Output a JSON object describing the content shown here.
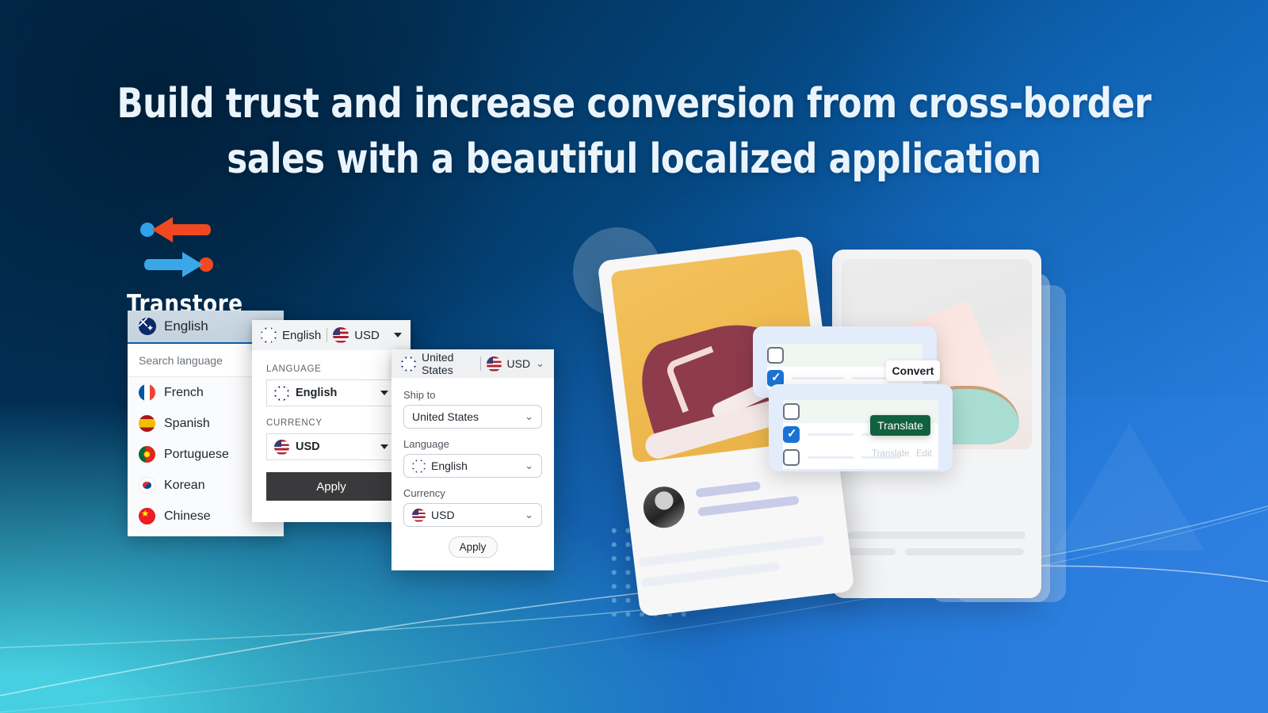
{
  "hero": {
    "headline": "Build trust and increase conversion from cross-border\nsales with a beautiful localized application",
    "headline_color": "#eaf4fc"
  },
  "logo": {
    "wordmark": "Transtore",
    "arrow_left_color": "#f1491f",
    "arrow_right_color": "#3aa8e8",
    "dot_left_color": "#2fa3e8",
    "dot_right_color": "#f1491f"
  },
  "widget_language_list": {
    "selected": {
      "label": "English",
      "flag": "flag-australia-icon"
    },
    "search_placeholder": "Search language",
    "items": [
      {
        "label": "French",
        "flag": "flag-france-icon"
      },
      {
        "label": "Spanish",
        "flag": "flag-spain-icon"
      },
      {
        "label": "Portuguese",
        "flag": "flag-portugal-icon"
      },
      {
        "label": "Korean",
        "flag": "flag-korea-icon"
      },
      {
        "label": "Chinese",
        "flag": "flag-china-icon"
      }
    ]
  },
  "widget_lang_currency": {
    "pill": {
      "language": "English",
      "separator": "|",
      "currency": "USD"
    },
    "language_label": "LANGUAGE",
    "language_value": "English",
    "currency_label": "CURRENCY",
    "currency_value": "USD",
    "apply_label": "Apply",
    "apply_bg": "#3a3a3c"
  },
  "widget_ship_to": {
    "pill": {
      "country": "United States",
      "currency": "USD"
    },
    "ship_to_label": "Ship to",
    "ship_to_value": "United States",
    "language_label": "Language",
    "language_value": "English",
    "currency_label": "Currency",
    "currency_value": "USD",
    "apply_label": "Apply"
  },
  "mock_overlays": {
    "convert_button": "Convert",
    "translate_button": "Translate",
    "ghost_translate": "Translate",
    "ghost_edit": "Edit",
    "translate_bg": "#11603f"
  },
  "background": {
    "top_left": "#023158",
    "bottom_left": "#46cfe0",
    "bottom_right": "#2d86e8",
    "dot_color": "#5ba3dd"
  }
}
